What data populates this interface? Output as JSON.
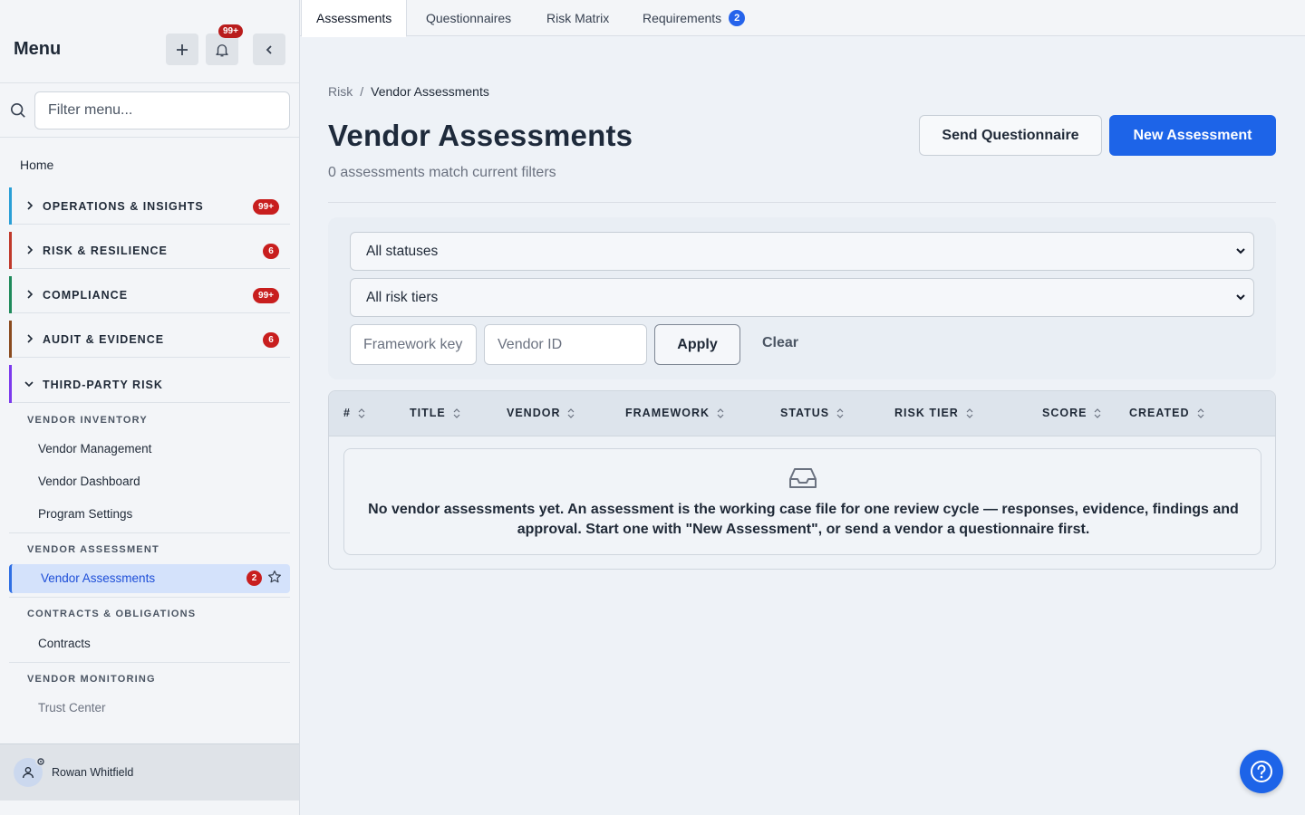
{
  "sidebar": {
    "title": "Menu",
    "notifications_badge": "99+",
    "filter_placeholder": "Filter menu...",
    "home": "Home",
    "sections": [
      {
        "label": "OPERATIONS & INSIGHTS",
        "count": "99+",
        "color": "#2a9fd6"
      },
      {
        "label": "RISK & RESILIENCE",
        "count": "6",
        "color": "#c0392b"
      },
      {
        "label": "COMPLIANCE",
        "count": "99+",
        "color": "#1f8a5b"
      },
      {
        "label": "AUDIT & EVIDENCE",
        "count": "6",
        "color": "#8a4b1f"
      },
      {
        "label": "THIRD-PARTY RISK",
        "count": "",
        "color": "#7c3aed"
      }
    ],
    "groups": {
      "vendor_inventory": "VENDOR INVENTORY",
      "vendor_assessment": "VENDOR ASSESSMENT",
      "contracts_obligations": "CONTRACTS & OBLIGATIONS",
      "vendor_monitoring": "VENDOR MONITORING"
    },
    "items": {
      "vendor_management": "Vendor Management",
      "vendor_dashboard": "Vendor Dashboard",
      "program_settings": "Program Settings",
      "vendor_assessments": "Vendor Assessments",
      "vendor_assessments_count": "2",
      "contracts": "Contracts",
      "trust_center": "Trust Center"
    },
    "user": "Rowan Whitfield"
  },
  "tabs": [
    {
      "label": "Assessments"
    },
    {
      "label": "Questionnaires"
    },
    {
      "label": "Risk Matrix"
    },
    {
      "label": "Requirements",
      "badge": "2"
    }
  ],
  "breadcrumb": {
    "parent": "Risk",
    "separator": "/",
    "current": "Vendor Assessments"
  },
  "page": {
    "title": "Vendor Assessments",
    "subtitle": "0 assessments match current filters",
    "send_questionnaire": "Send Questionnaire",
    "new_assessment": "New Assessment"
  },
  "filters": {
    "status": "All statuses",
    "risk_tier": "All risk tiers",
    "framework_placeholder": "Framework key",
    "vendor_placeholder": "Vendor ID",
    "apply": "Apply",
    "clear": "Clear"
  },
  "table": {
    "columns": [
      "#",
      "TITLE",
      "VENDOR",
      "FRAMEWORK",
      "STATUS",
      "RISK TIER",
      "SCORE",
      "CREATED"
    ],
    "empty_message": "No vendor assessments yet. An assessment is the working case file for one review cycle — responses, evidence, findings and approval. Start one with \"New Assessment\", or send a vendor a questionnaire first."
  },
  "colors": {
    "accent": "#1d64e8",
    "badge_red": "#c81e1e",
    "active_bg": "#d4e2fb"
  }
}
